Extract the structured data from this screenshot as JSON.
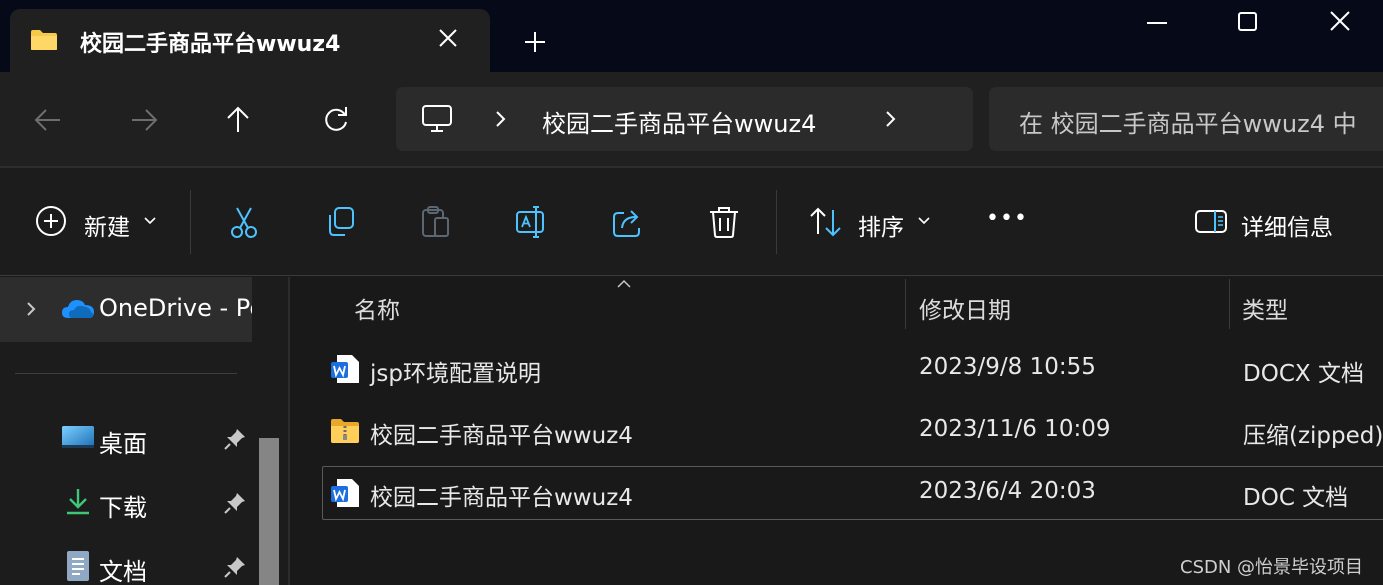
{
  "window": {
    "tab_title": "校园二手商品平台wwuz4",
    "controls": [
      "minimize-icon",
      "maximize-icon",
      "close-icon"
    ]
  },
  "address_bar": {
    "location": "校园二手商品平台wwuz4",
    "search_placeholder": "在 校园二手商品平台wwuz4 中"
  },
  "toolbar": {
    "new_label": "新建",
    "sort_label": "排序",
    "more_label": "•••",
    "details_label": "详细信息",
    "icons": [
      "cut-icon",
      "copy-icon",
      "paste-icon",
      "rename-icon",
      "share-icon",
      "delete-icon"
    ]
  },
  "nav_pane": {
    "onedrive_label": "OneDrive - Pe",
    "quick_access": [
      {
        "label": "桌面",
        "icon": "desktop-icon"
      },
      {
        "label": "下载",
        "icon": "download-icon"
      },
      {
        "label": "文档",
        "icon": "documents-icon"
      }
    ]
  },
  "file_list": {
    "columns": [
      "名称",
      "修改日期",
      "类型"
    ],
    "rows": [
      {
        "name": "jsp环境配置说明",
        "modified": "2023/9/8 10:55",
        "type": "DOCX 文档",
        "icon": "word-doc-icon",
        "selected": false
      },
      {
        "name": "校园二手商品平台wwuz4",
        "modified": "2023/11/6 10:09",
        "type": "压缩(zipped)",
        "icon": "zip-folder-icon",
        "selected": false
      },
      {
        "name": "校园二手商品平台wwuz4",
        "modified": "2023/6/4 20:03",
        "type": "DOC 文档",
        "icon": "word-doc-icon",
        "selected": true
      }
    ]
  },
  "watermark": "CSDN @怡景毕设项目",
  "colors": {
    "accent": "#4cc2ff",
    "folder": "#f8c84a",
    "word": "#1d6fe0"
  }
}
